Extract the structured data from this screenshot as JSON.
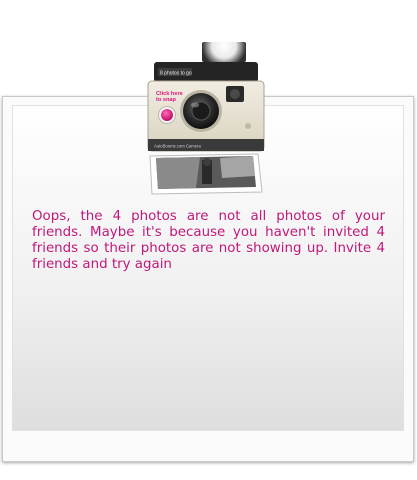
{
  "camera": {
    "label_top": "8 photos to go",
    "button_text_line1": "Click here",
    "button_text_line2": "to snap",
    "brand": "AutoBooms.com Camera"
  },
  "message": {
    "text": "Oops, the 4 photos are not all photos of your friends. Maybe it's because you haven't invited 4 friends so their photos are not showing up. Invite 4 friends and try again"
  },
  "colors": {
    "message": "#c0187a",
    "snap_button": "#e0147e"
  },
  "icons": [
    "camera-icon",
    "flash-icon",
    "shutter-button-icon",
    "photo-print-icon"
  ]
}
